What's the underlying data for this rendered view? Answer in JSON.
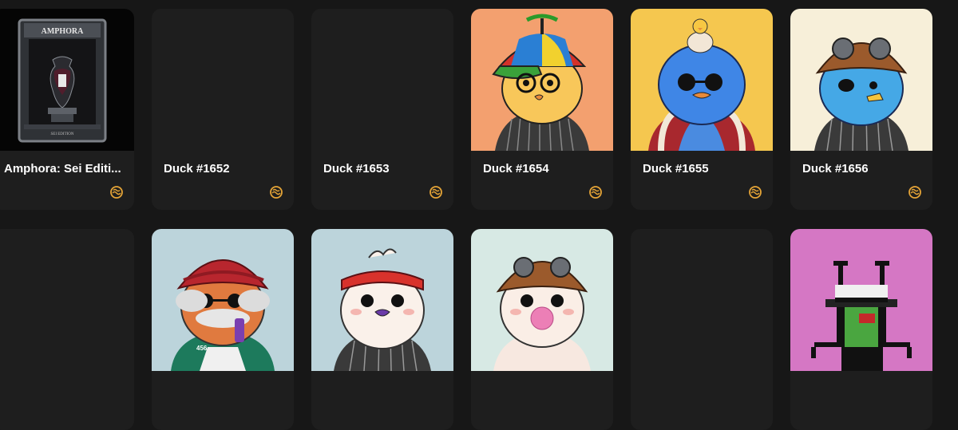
{
  "chain_icon": "sei-icon",
  "colors": {
    "page_bg": "#171717",
    "card_bg": "#1e1e1e",
    "chain_icon": "#e5a437"
  },
  "cards": [
    {
      "name": "Amphora: Sei Edition",
      "title": "Amphora: Sei Editi...",
      "badge_text": "AMPHORA",
      "badge_subtext": "SEI EDITION",
      "image": "amphora-artwork"
    },
    {
      "name": "Duck #1652",
      "title": "Duck #1652",
      "image": "empty"
    },
    {
      "name": "Duck #1653",
      "title": "Duck #1653",
      "image": "empty"
    },
    {
      "name": "Duck #1654",
      "title": "Duck #1654",
      "image": "duck-propeller-cap"
    },
    {
      "name": "Duck #1655",
      "title": "Duck #1655",
      "image": "duck-blue-chick-hat"
    },
    {
      "name": "Duck #1656",
      "title": "Duck #1656",
      "image": "duck-aviator-eyepatch"
    },
    {
      "image": "empty"
    },
    {
      "image": "duck-turban-beard",
      "jersey_number": "456"
    },
    {
      "image": "duck-bandana"
    },
    {
      "image": "duck-aviator-bubblegum"
    },
    {
      "image": "empty"
    },
    {
      "image": "pixel-ant-hat"
    }
  ]
}
